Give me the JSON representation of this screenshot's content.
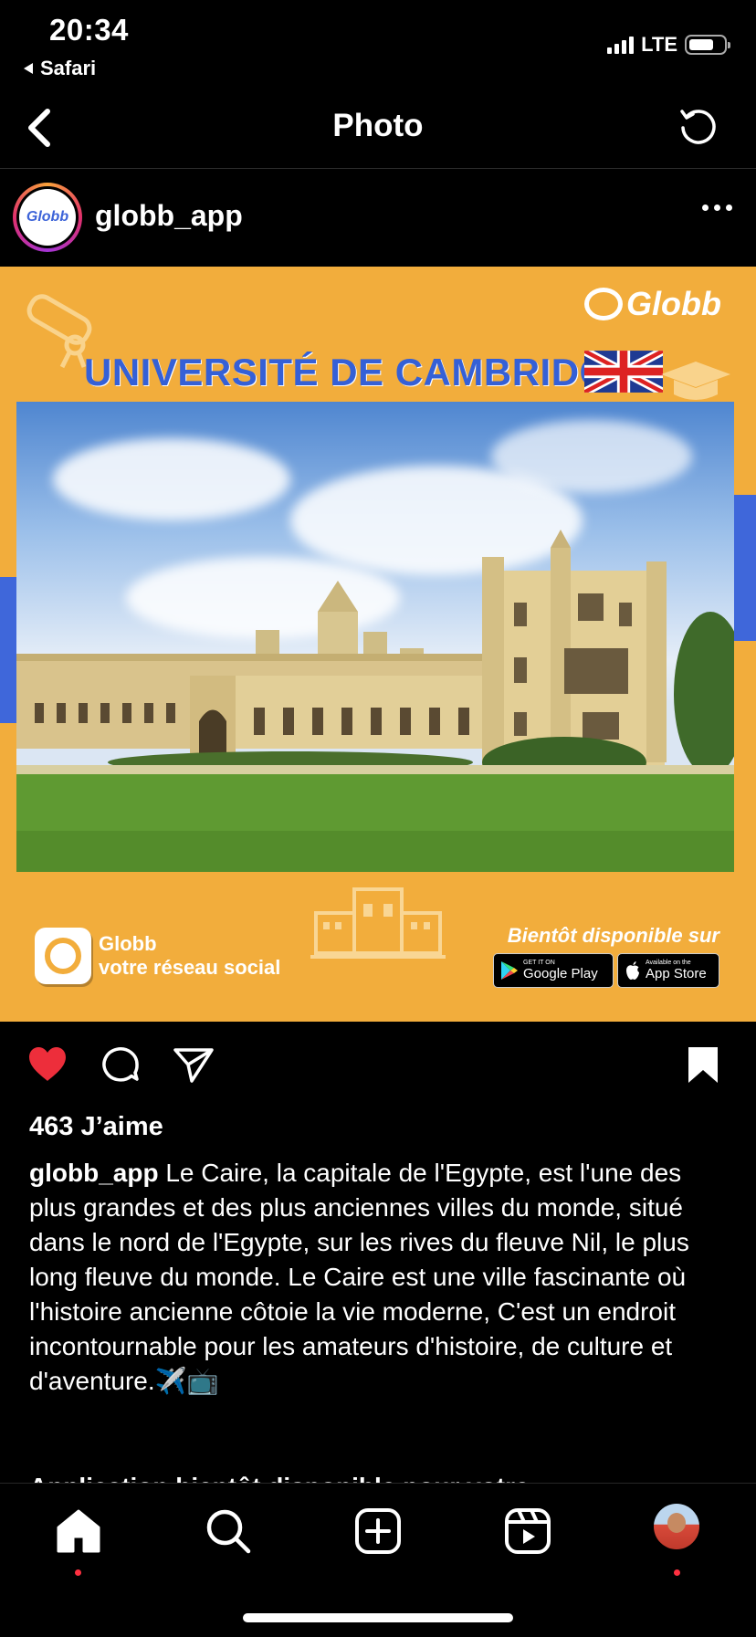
{
  "status_bar": {
    "time": "20:34",
    "back_app": "Safari",
    "network": "LTE"
  },
  "nav": {
    "title": "Photo",
    "back_icon": "chevron-left-icon",
    "refresh_icon": "refresh-icon"
  },
  "post": {
    "username": "globb_app",
    "avatar_text": "Globb",
    "image": {
      "brand": "Globb",
      "headline": "UNIVERSITÉ DE CAMBRIDGE",
      "footer_brand_name": "Globb",
      "footer_tagline": "votre réseau social",
      "availability": "Bientôt disponible sur",
      "google_play_small": "GET IT ON",
      "google_play_big": "Google Play",
      "app_store_small": "Available on the",
      "app_store_big": "App Store"
    },
    "likes": "463 J’aime",
    "caption_user": "globb_app",
    "caption_text": " Le Caire, la capitale de l'Egypte, est l'une des plus grandes et des plus anciennes villes du monde, situé dans le nord de l'Egypte, sur les rives du fleuve Nil, le plus long fleuve du monde. Le Caire est une ville fascinante où l'histoire ancienne côtoie la vie moderne, C'est un endroit incontournable pour les amateurs d'histoire, de culture et d'aventure.✈️📺",
    "caption_next_line": "Application bientôt disponible pour votre ..."
  },
  "colors": {
    "like_red": "#ed2e3b",
    "poster_orange": "#f2ad3c",
    "headline_blue": "#3560d6"
  },
  "tabs": [
    {
      "icon": "home-icon"
    },
    {
      "icon": "search-icon"
    },
    {
      "icon": "add-post-icon"
    },
    {
      "icon": "reels-icon"
    },
    {
      "icon": "profile-avatar-icon"
    }
  ]
}
